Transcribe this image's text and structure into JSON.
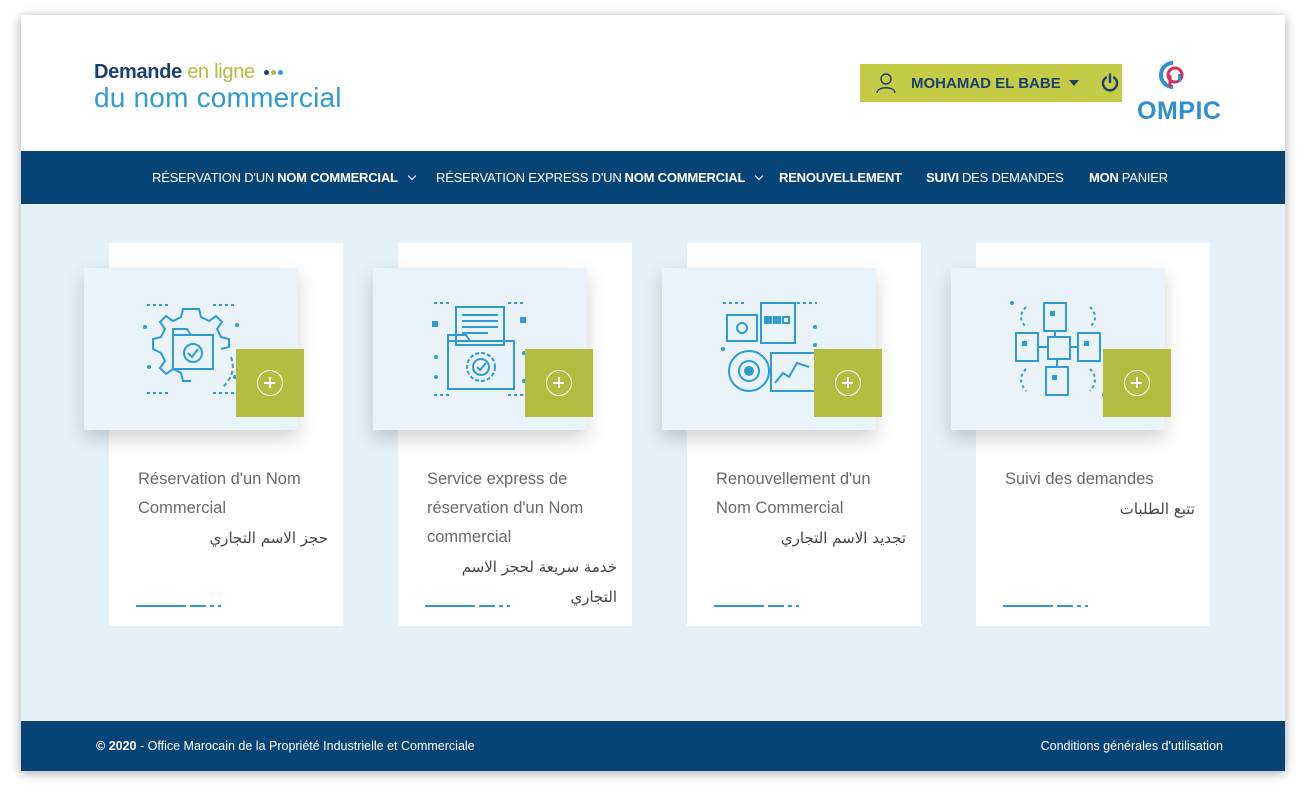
{
  "colors": {
    "navy": "#064477",
    "lime": "#b3bd3f",
    "blue": "#2f9bd5",
    "background": "#e6f0f7"
  },
  "logo": {
    "word1": "Demande",
    "word2": "en ligne",
    "line2": "du nom commercial"
  },
  "user": {
    "name": "MOHAMAD EL BABE",
    "icon": "user-icon",
    "logout_icon": "power-icon"
  },
  "brand": {
    "name": "OMPIC"
  },
  "nav": {
    "items": [
      {
        "pre": "RÉSERVATION D'UN",
        "bold": "NOM COMMERCIAL",
        "post": "",
        "dropdown": true
      },
      {
        "pre": "RÉSERVATION EXPRESS D'UN",
        "bold": "NOM COMMERCIAL",
        "post": "",
        "dropdown": true
      },
      {
        "pre": "",
        "bold": "RENOUVELLEMENT",
        "post": "",
        "dropdown": false
      },
      {
        "pre": "",
        "bold": "SUIVI",
        "post": "DES DEMANDES",
        "dropdown": false
      },
      {
        "pre": "",
        "bold": "MON",
        "post": "PANIER",
        "dropdown": false
      }
    ]
  },
  "cards": [
    {
      "title": "Réservation d'un Nom Commercial",
      "arabic": "حجز الاسم التجاري",
      "icon": "folder-gear-icon",
      "action": "plus-icon"
    },
    {
      "title": "Service express de réservation d'un Nom commercial",
      "arabic": "خدمة سريعة لحجز الاسم التجاري",
      "icon": "documents-folder-icon",
      "action": "plus-icon"
    },
    {
      "title": "Renouvellement d'un Nom Commercial",
      "arabic": "تجديد الاسم التجاري",
      "icon": "gear-chart-icon",
      "action": "plus-icon"
    },
    {
      "title": "Suivi des demandes",
      "arabic": "تتبع الطلبات",
      "icon": "network-documents-icon",
      "action": "plus-icon"
    }
  ],
  "footer": {
    "year": "2020",
    "org": "- Office Marocain de la Propriété Industrielle et Commerciale",
    "terms": "Conditions générales d'utilisation"
  }
}
